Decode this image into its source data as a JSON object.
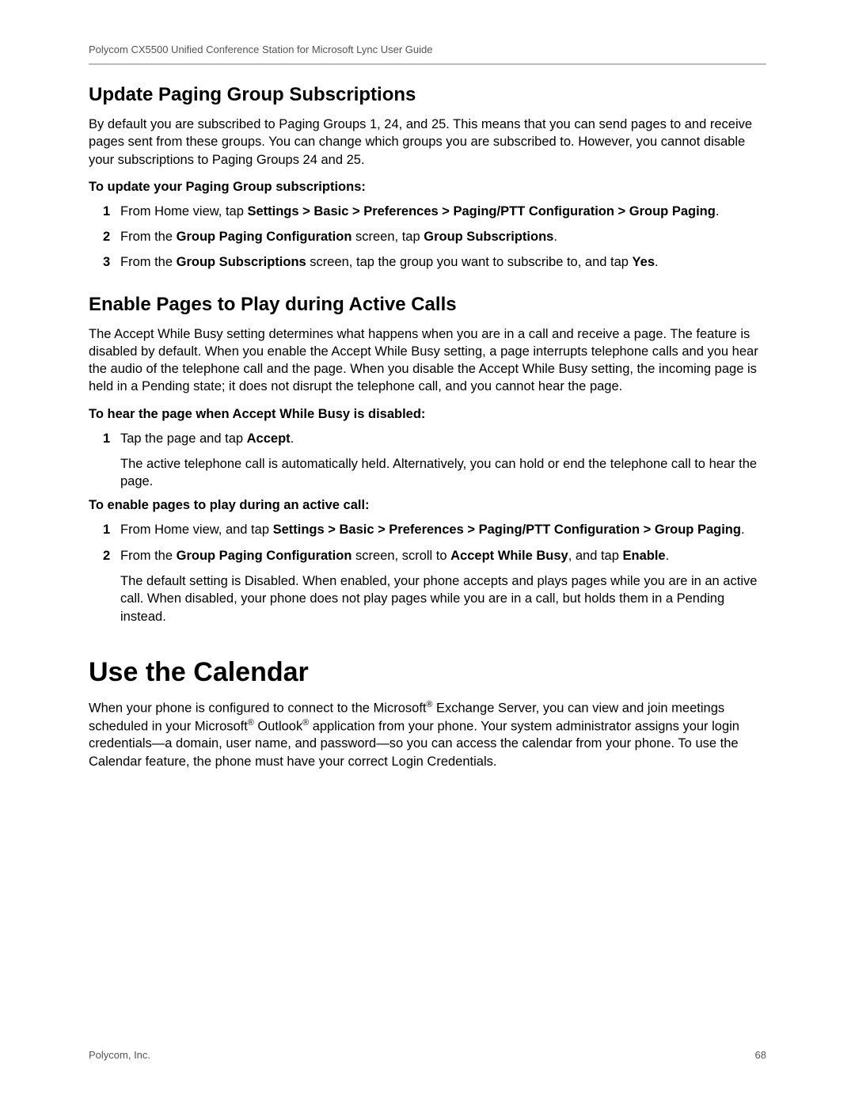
{
  "header": {
    "running": "Polycom CX5500 Unified Conference Station for Microsoft Lync User Guide"
  },
  "section1": {
    "title": "Update Paging Group Subscriptions",
    "intro": "By default you are subscribed to Paging Groups 1, 24, and 25. This means that you can send pages to and receive pages sent from these groups. You can change which groups you are subscribed to. However, you cannot disable your subscriptions to Paging Groups 24 and 25.",
    "lead": "To update your Paging Group subscriptions:",
    "steps": {
      "n1": "1",
      "s1a": "From Home view, tap ",
      "s1b": "Settings > Basic > Preferences > Paging/PTT Configuration > Group Paging",
      "s1c": ".",
      "n2": "2",
      "s2a": "From the ",
      "s2b": "Group Paging Configuration",
      "s2c": " screen, tap ",
      "s2d": "Group Subscriptions",
      "s2e": ".",
      "n3": "3",
      "s3a": "From the ",
      "s3b": "Group Subscriptions",
      "s3c": " screen, tap the group you want to subscribe to, and tap ",
      "s3d": "Yes",
      "s3e": "."
    }
  },
  "section2": {
    "title": "Enable Pages to Play during Active Calls",
    "intro": "The Accept While Busy setting determines what happens when you are in a call and receive a page. The feature is disabled by default. When you enable the Accept While Busy setting, a page interrupts telephone calls and you hear the audio of the telephone call and the page. When you disable the Accept While Busy setting, the incoming page is held in a Pending state; it does not disrupt the telephone call, and you cannot hear the page.",
    "lead1": "To hear the page when Accept While Busy is disabled:",
    "steps1": {
      "n1": "1",
      "s1a": "Tap the page and tap ",
      "s1b": "Accept",
      "s1c": ".",
      "sub": "The active telephone call is automatically held. Alternatively, you can hold or end the telephone call to hear the page."
    },
    "lead2": "To enable pages to play during an active call:",
    "steps2": {
      "n1": "1",
      "s1a": "From Home view, and tap ",
      "s1b": "Settings > Basic > Preferences > Paging/PTT Configuration > Group Paging",
      "s1c": ".",
      "n2": "2",
      "s2a": "From the ",
      "s2b": "Group Paging Configuration",
      "s2c": " screen, scroll to ",
      "s2d": "Accept While Busy",
      "s2e": ", and tap ",
      "s2f": "Enable",
      "s2g": ".",
      "sub": "The default setting is Disabled. When enabled, your phone accepts and plays pages while you are in an active call. When disabled, your phone does not play pages while you are in a call, but holds them in a Pending instead."
    }
  },
  "section3": {
    "title": "Use the Calendar",
    "p": {
      "a": "When your phone is configured to connect to the Microsoft",
      "b": " Exchange Server, you can view and join meetings scheduled in your Microsoft",
      "c": " Outlook",
      "d": " application from your phone. Your system administrator assigns your login credentials—a domain, user name, and password—so you can access the calendar from your phone. To use the Calendar feature, the phone must have your correct Login Credentials."
    }
  },
  "footer": {
    "left": "Polycom, Inc.",
    "right": "68"
  }
}
